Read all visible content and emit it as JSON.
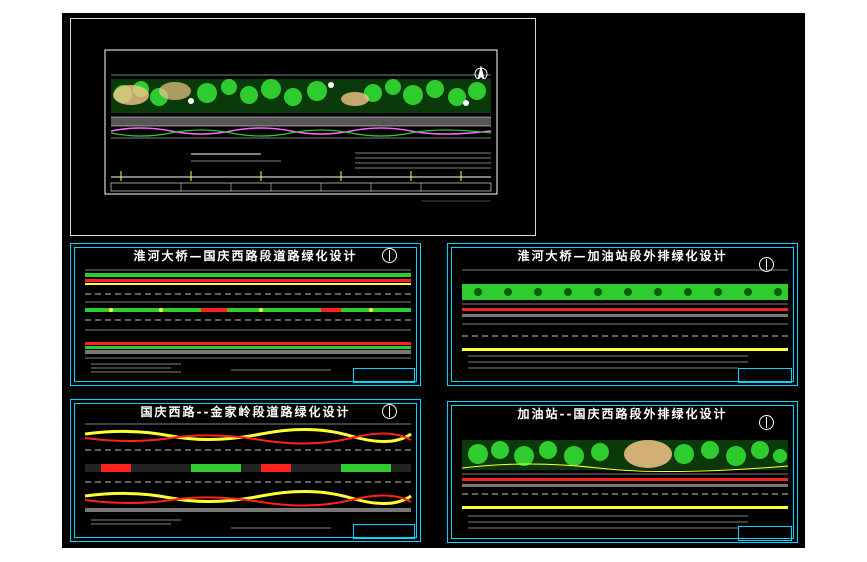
{
  "sheets": {
    "s1": {
      "title": "淮河大桥—国庆西路段道路绿化设计"
    },
    "s2": {
      "title": "淮河大桥—加油站段外排绿化设计"
    },
    "s3": {
      "title": "国庆西路--金家岭段道路绿化设计"
    },
    "s4": {
      "title": "加油站--国庆西路段外排绿化设计"
    }
  },
  "colors": {
    "background": "#000000",
    "frame": "#00d4ff",
    "tree_green": "#2ecc2e",
    "accent_red": "#ff2020",
    "accent_yellow": "#ffff33",
    "peach": "#f4c48a"
  }
}
